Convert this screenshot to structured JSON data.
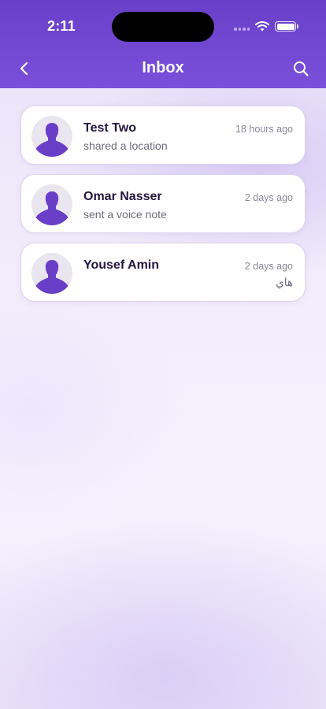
{
  "status_bar": {
    "time": "2:11"
  },
  "header": {
    "title": "Inbox"
  },
  "colors": {
    "accent": "#6a3fc8",
    "avatar_silhouette": "#6a3fc8"
  },
  "conversations": [
    {
      "name": "Test Two",
      "preview": "shared a location",
      "time": "18 hours ago"
    },
    {
      "name": "Omar Nasser",
      "preview": "sent a voice note",
      "time": "2 days ago"
    },
    {
      "name": "Yousef Amin",
      "preview": "هاي",
      "time": "2 days ago"
    }
  ]
}
